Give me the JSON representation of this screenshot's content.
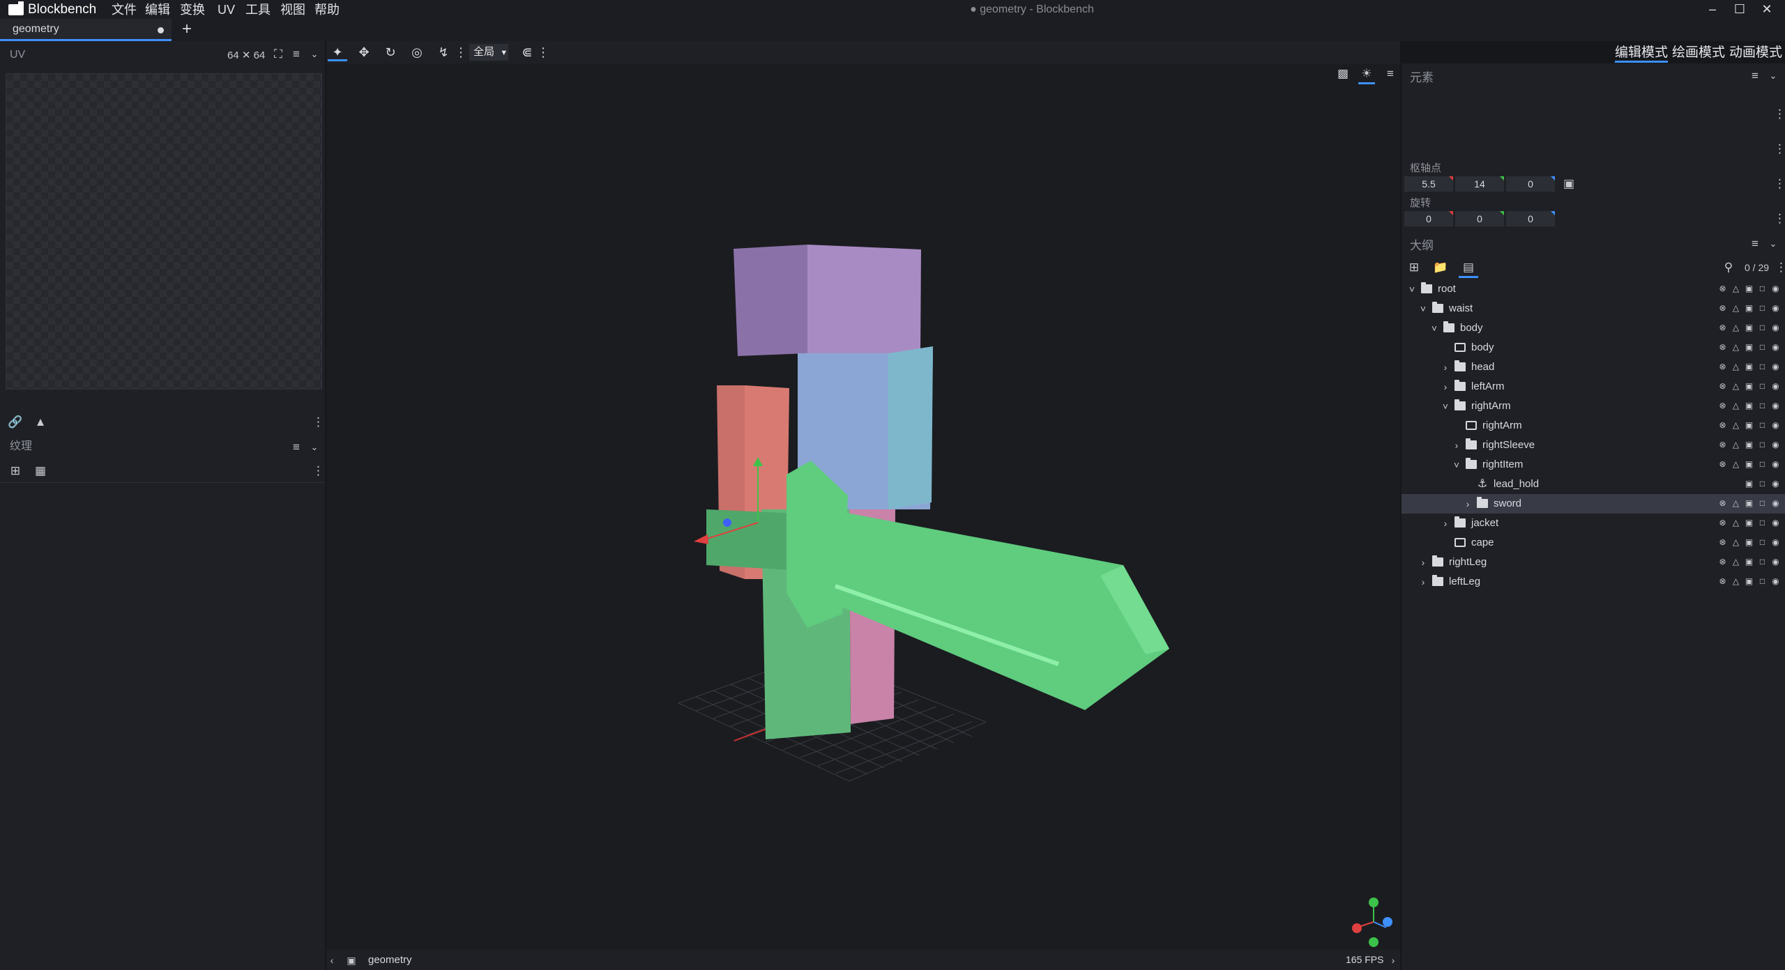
{
  "app": {
    "name": "Blockbench",
    "window_title": "● geometry - Blockbench",
    "menu": [
      "文件",
      "编辑",
      "变换",
      "UV",
      "工具",
      "视图",
      "帮助"
    ]
  },
  "tabs": [
    {
      "label": "geometry",
      "unsaved": true
    }
  ],
  "uv_panel": {
    "title": "UV",
    "size": "64 ✕ 64"
  },
  "texture_panel": {
    "title": "纹理"
  },
  "toolbar": {
    "space_mode": "全局"
  },
  "modes": [
    "编辑模式",
    "绘画模式",
    "动画模式"
  ],
  "element_panel": {
    "title": "元素",
    "pivot_label": "枢轴点",
    "pivot": [
      "5.5",
      "14",
      "0"
    ],
    "rotation_label": "旋转",
    "rotation": [
      "0",
      "0",
      "0"
    ]
  },
  "outliner": {
    "title": "大纲",
    "count": "0 / 29",
    "items": [
      {
        "name": "root",
        "type": "group",
        "expanded": true,
        "depth": 0
      },
      {
        "name": "waist",
        "type": "group",
        "expanded": true,
        "depth": 1
      },
      {
        "name": "body",
        "type": "group",
        "expanded": true,
        "depth": 2
      },
      {
        "name": "body",
        "type": "cube",
        "depth": 3
      },
      {
        "name": "head",
        "type": "group",
        "expanded": false,
        "depth": 3
      },
      {
        "name": "leftArm",
        "type": "group",
        "expanded": false,
        "depth": 3
      },
      {
        "name": "rightArm",
        "type": "group",
        "expanded": true,
        "depth": 3
      },
      {
        "name": "rightArm",
        "type": "cube",
        "depth": 4
      },
      {
        "name": "rightSleeve",
        "type": "group",
        "expanded": false,
        "depth": 4
      },
      {
        "name": "rightItem",
        "type": "group",
        "expanded": true,
        "depth": 4
      },
      {
        "name": "lead_hold",
        "type": "locator",
        "depth": 5
      },
      {
        "name": "sword",
        "type": "group",
        "expanded": false,
        "depth": 5,
        "selected": true
      },
      {
        "name": "jacket",
        "type": "group",
        "expanded": false,
        "depth": 3
      },
      {
        "name": "cape",
        "type": "cube",
        "depth": 3
      },
      {
        "name": "rightLeg",
        "type": "group",
        "expanded": false,
        "depth": 1
      },
      {
        "name": "leftLeg",
        "type": "group",
        "expanded": false,
        "depth": 1
      }
    ]
  },
  "status": {
    "model_name": "geometry",
    "fps": "165 FPS"
  },
  "colors": {
    "accent": "#3e90ff",
    "head": "#a98bc4",
    "arm": "#d97a72",
    "body": "#8ba6d4",
    "sword": "#5fcc7e",
    "leg_right": "#c982a8"
  }
}
